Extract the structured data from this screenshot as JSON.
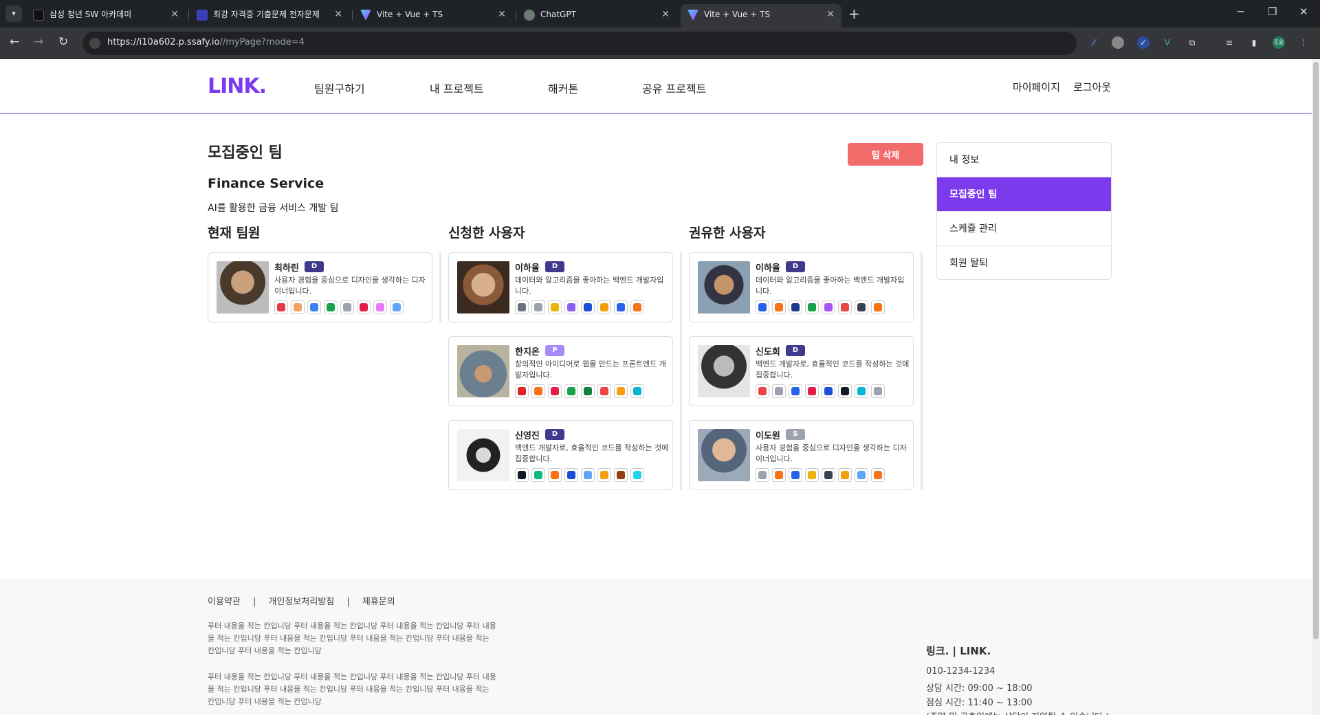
{
  "browser": {
    "tabs": [
      {
        "title": "삼성 청년 SW 아카데미",
        "fav_color": "#111111"
      },
      {
        "title": "최강 자격증 기출문제 전자문제",
        "fav_color": "#3b3fb6"
      },
      {
        "title": "Vite + Vue + TS",
        "fav_color": "#8b5cf6"
      },
      {
        "title": "ChatGPT",
        "fav_color": "#6b7d72"
      },
      {
        "title": "Vite + Vue + TS",
        "fav_color": "#8b5cf6"
      }
    ],
    "active_tab": 4,
    "url_main": "https://i10a602.p.ssafy.io",
    "url_path": "//myPage?mode=4",
    "profile_initials": "종율"
  },
  "header": {
    "logo": "LINK.",
    "nav": [
      "팀원구하기",
      "내 프로젝트",
      "해커톤",
      "공유 프로젝트"
    ],
    "mypage": "마이페이지",
    "logout": "로그아웃"
  },
  "main": {
    "title": "모집중인 팀",
    "delete_button": "팀 삭제",
    "team_name": "Finance Service",
    "team_desc": "AI를 활용한 금융 서비스 개발 팀",
    "columns": [
      "현재 팀원",
      "신청한 사용자",
      "권유한 사용자"
    ]
  },
  "members": {
    "current": [
      {
        "name": "최하린",
        "badge": "D",
        "badge_color": "#3f3a8c",
        "desc": "사용자 경험을 중심으로 디자인을 생각하는 디자이너입니다.",
        "skills": [
          "#e63946",
          "#f4a261",
          "#3b82f6",
          "#16a34a",
          "#9ca3af",
          "#e11d48",
          "#e879f9",
          "#60a5fa"
        ]
      }
    ],
    "applied": [
      {
        "name": "이하율",
        "badge": "D",
        "badge_color": "#3f3a8c",
        "desc": "데이터와 알고리즘을 좋아하는 백엔드 개발자입니다.",
        "skills": [
          "#6b7280",
          "#9ca3af",
          "#eab308",
          "#8b5cf6",
          "#1d4ed8",
          "#f59e0b",
          "#2563eb",
          "#f97316"
        ]
      },
      {
        "name": "한지온",
        "badge": "P",
        "badge_color": "#a78bfa",
        "desc": "창의적인 아이디어로 웹을 만드는 프론트엔드 개발자입니다.",
        "skills": [
          "#dc2626",
          "#f97316",
          "#e11d48",
          "#16a34a",
          "#15803d",
          "#ef4444",
          "#f59e0b",
          "#06b6d4"
        ]
      },
      {
        "name": "신영진",
        "badge": "D",
        "badge_color": "#3f3a8c",
        "desc": "백엔드 개발자로, 효율적인 코드를 작성하는 것에 집중합니다.",
        "skills": [
          "#111827",
          "#10b981",
          "#f97316",
          "#1d4ed8",
          "#60a5fa",
          "#f59e0b",
          "#92400e",
          "#22d3ee"
        ]
      }
    ],
    "invited": [
      {
        "name": "이하율",
        "badge": "D",
        "badge_color": "#3f3a8c",
        "desc": "데이터와 알고리즘을 좋아하는 백엔드 개발자입니다.",
        "skills": [
          "#2563eb",
          "#f97316",
          "#1e3a8a",
          "#16a34a",
          "#a855f7",
          "#ef4444",
          "#374151",
          "#f97316"
        ]
      },
      {
        "name": "신도희",
        "badge": "D",
        "badge_color": "#3f3a8c",
        "desc": "백엔드 개발자로, 효율적인 코드를 작성하는 것에 집중합니다.",
        "skills": [
          "#ef4444",
          "#9ca3af",
          "#2563eb",
          "#e11d48",
          "#1d4ed8",
          "#111827",
          "#06b6d4",
          "#9ca3af"
        ]
      },
      {
        "name": "이도원",
        "badge": "S",
        "badge_color": "#9ca3af",
        "desc": "사용자 경험을 중심으로 디자인을 생각하는 디자이너입니다.",
        "skills": [
          "#9ca3af",
          "#f97316",
          "#2563eb",
          "#eab308",
          "#374151",
          "#f59e0b",
          "#60a5fa",
          "#f97316"
        ]
      }
    ]
  },
  "side_menu": [
    "내 정보",
    "모집중인 팀",
    "스케쥴 관리",
    "회원 탈퇴"
  ],
  "side_active": 1,
  "footer": {
    "links": [
      "이용약관",
      "|",
      "개인정보처리방침",
      "|",
      "제휴문의"
    ],
    "para1": "푸터 내용을 적는 칸입니당 푸터 내용을 적는 칸입니당 푸터 내용을 적는 칸입니당 푸터 내용을 적는 칸입니당 푸터 내용을 적는 칸입니당 푸터 내용을 적는 칸입니당 푸터 내용을 적는 칸입니당 푸터 내용을 적는 칸입니당",
    "para2": "푸터 내용을 적는 칸입니당 푸터 내용을 적는 칸입니당 푸터 내용을 적는 칸입니당 푸터 내용을 적는 칸입니당 푸터 내용을 적는 칸입니당 푸터 내용을 적는 칸입니당 푸터 내용을 적는 칸입니당 푸터 내용을 적는 칸입니당",
    "company": "링크. | LINK.",
    "phone": "010-1234-1234",
    "hours": "상담 시간: 09:00 ~ 18:00",
    "lunch": "점심 시간: 11:40 ~ 13:00",
    "note": "(주말 및 공휴일에는 상담이 지연될 수 있습니다.)"
  }
}
